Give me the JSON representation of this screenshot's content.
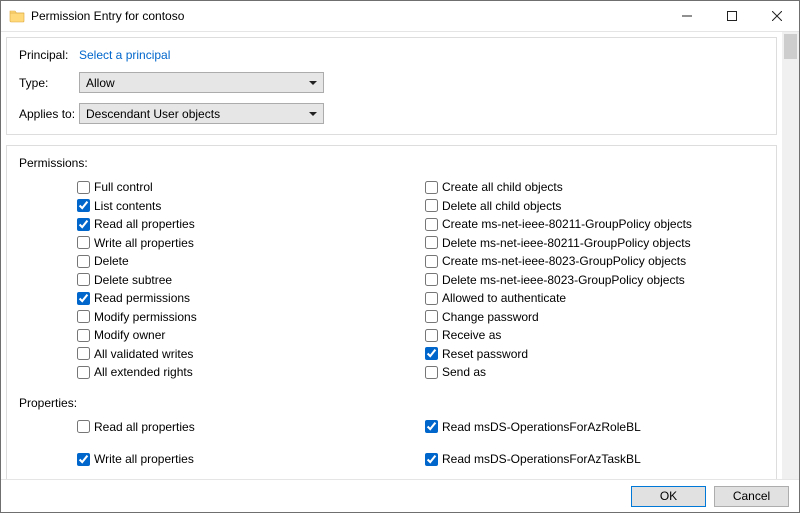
{
  "window": {
    "title": "Permission Entry for contoso"
  },
  "header": {
    "principal_label": "Principal:",
    "principal_link": "Select a principal",
    "type_label": "Type:",
    "type_value": "Allow",
    "applies_label": "Applies to:",
    "applies_value": "Descendant User objects"
  },
  "permissions": {
    "section_label": "Permissions:",
    "left": [
      {
        "label": "Full control",
        "checked": false
      },
      {
        "label": "List contents",
        "checked": true
      },
      {
        "label": "Read all properties",
        "checked": true
      },
      {
        "label": "Write all properties",
        "checked": false
      },
      {
        "label": "Delete",
        "checked": false
      },
      {
        "label": "Delete subtree",
        "checked": false
      },
      {
        "label": "Read permissions",
        "checked": true
      },
      {
        "label": "Modify permissions",
        "checked": false
      },
      {
        "label": "Modify owner",
        "checked": false
      },
      {
        "label": "All validated writes",
        "checked": false
      },
      {
        "label": "All extended rights",
        "checked": false
      }
    ],
    "right": [
      {
        "label": "Create all child objects",
        "checked": false
      },
      {
        "label": "Delete all child objects",
        "checked": false
      },
      {
        "label": "Create ms-net-ieee-80211-GroupPolicy objects",
        "checked": false
      },
      {
        "label": "Delete ms-net-ieee-80211-GroupPolicy objects",
        "checked": false
      },
      {
        "label": "Create ms-net-ieee-8023-GroupPolicy objects",
        "checked": false
      },
      {
        "label": "Delete ms-net-ieee-8023-GroupPolicy objects",
        "checked": false
      },
      {
        "label": "Allowed to authenticate",
        "checked": false
      },
      {
        "label": "Change password",
        "checked": false
      },
      {
        "label": "Receive as",
        "checked": false
      },
      {
        "label": "Reset password",
        "checked": true
      },
      {
        "label": "Send as",
        "checked": false
      }
    ]
  },
  "properties": {
    "section_label": "Properties:",
    "left": [
      {
        "label": "Read all properties",
        "checked": false
      },
      {
        "label": "Write all properties",
        "checked": true
      }
    ],
    "right": [
      {
        "label": "Read msDS-OperationsForAzRoleBL",
        "checked": true
      },
      {
        "label": "Read msDS-OperationsForAzTaskBL",
        "checked": true
      }
    ]
  },
  "footer": {
    "ok": "OK",
    "cancel": "Cancel"
  }
}
